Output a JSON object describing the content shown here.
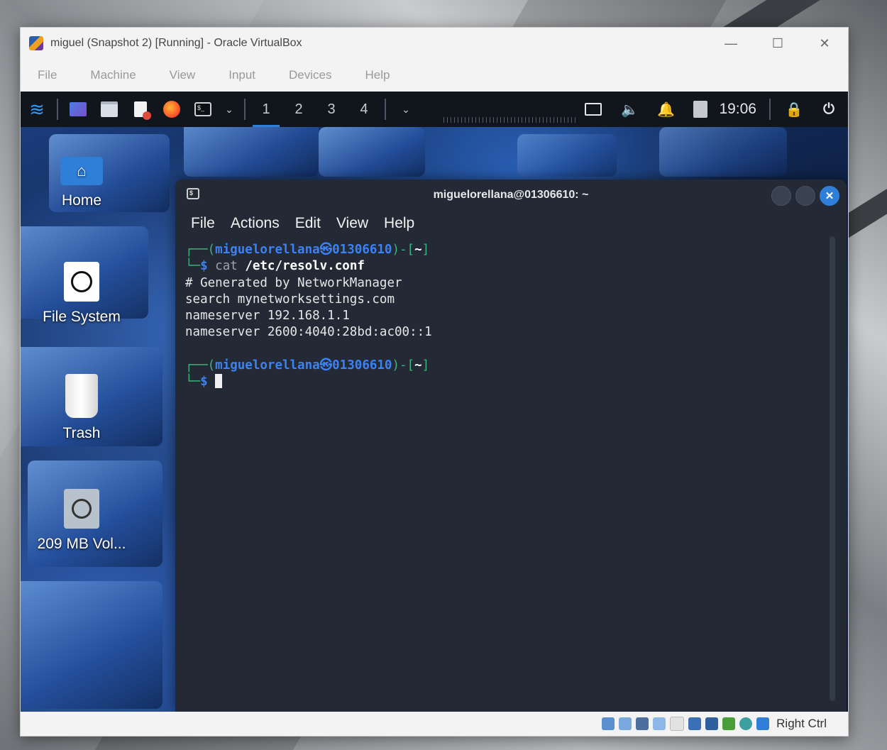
{
  "host": {
    "window_title": "miguel (Snapshot 2) [Running] - Oracle VirtualBox",
    "menu": [
      "File",
      "Machine",
      "View",
      "Input",
      "Devices",
      "Help"
    ],
    "controls": {
      "minimize": "—",
      "maximize": "☐",
      "close": "✕"
    },
    "host_key": "Right Ctrl"
  },
  "panel": {
    "workspaces": [
      "1",
      "2",
      "3",
      "4"
    ],
    "active_workspace": "1",
    "clock": "19:06"
  },
  "desktop": {
    "icons": [
      {
        "label": "Home",
        "icon": "home-icon"
      },
      {
        "label": "File System",
        "icon": "drive-icon"
      },
      {
        "label": "Trash",
        "icon": "trash-icon"
      },
      {
        "label": "209 MB Vol...",
        "icon": "volume-icon"
      }
    ]
  },
  "terminal": {
    "title": "miguelorellana@01306610: ~",
    "menu": [
      "File",
      "Actions",
      "Edit",
      "View",
      "Help"
    ],
    "prompt_user": "miguelorellana",
    "prompt_host": "01306610",
    "prompt_dir": "~",
    "command": "cat",
    "command_arg": "/etc/resolv.conf",
    "output": [
      "# Generated by NetworkManager",
      "search mynetworksettings.com",
      "nameserver 192.168.1.1",
      "nameserver 2600:4040:28bd:ac00::1"
    ]
  },
  "colors": {
    "accent": "#2f7fd8",
    "prompt_green": "#3fb17a",
    "prompt_blue": "#3b82f6"
  }
}
